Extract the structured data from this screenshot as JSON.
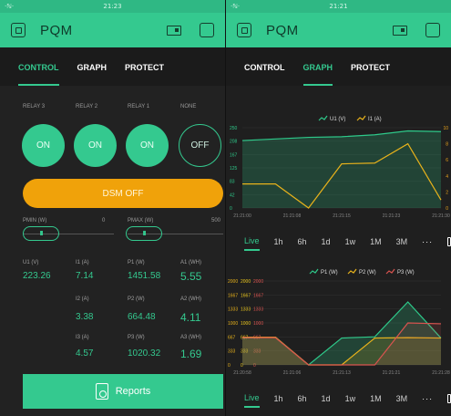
{
  "left": {
    "status": {
      "left": "·ℕ·",
      "time": "21:23",
      "right": ""
    },
    "header": {
      "title": "PQM",
      "icon": "device-icon"
    },
    "tabs": [
      {
        "label": "CONTROL",
        "active": true
      },
      {
        "label": "GRAPH",
        "active": false
      },
      {
        "label": "PROTECT",
        "active": false
      }
    ],
    "relays": [
      {
        "label": "RELAY 3",
        "state": "ON"
      },
      {
        "label": "RELAY 2",
        "state": "ON"
      },
      {
        "label": "RELAY 1",
        "state": "ON"
      },
      {
        "label": "NONE",
        "state": "OFF"
      }
    ],
    "dsm": {
      "label": "DSM OFF"
    },
    "pmin": {
      "label": "PMIN (W)",
      "value": "0",
      "handle": "III"
    },
    "pmax": {
      "label": "PMAX (W)",
      "value": "500",
      "handle": "III"
    },
    "metrics": [
      {
        "label": "U1 (V)",
        "value": "223.26"
      },
      {
        "label": "I1 (A)",
        "value": "7.14"
      },
      {
        "label": "P1 (W)",
        "value": "1451.58"
      },
      {
        "label": "A1 (WH)",
        "value": "5.55"
      },
      {
        "label": "I2 (A)",
        "value": "3.38"
      },
      {
        "label": "P2 (W)",
        "value": "664.48"
      },
      {
        "label": "A2 (WH)",
        "value": "4.11"
      },
      {
        "label": "I3 (A)",
        "value": "4.57"
      },
      {
        "label": "P3 (W)",
        "value": "1020.32"
      },
      {
        "label": "A3 (WH)",
        "value": "1.69"
      }
    ],
    "reports": {
      "label": "Reports"
    }
  },
  "right": {
    "status": {
      "left": "·ℕ·",
      "time": "21:21",
      "right": ""
    },
    "header": {
      "title": "PQM",
      "icon": "device-icon"
    },
    "tabs": [
      {
        "label": "CONTROL",
        "active": false
      },
      {
        "label": "GRAPH",
        "active": true
      },
      {
        "label": "PROTECT",
        "active": false
      }
    ],
    "periods": [
      "Live",
      "1h",
      "6h",
      "1d",
      "1w",
      "1M",
      "3M"
    ],
    "more": "···"
  },
  "chart_data": [
    {
      "type": "line",
      "x": [
        "21:21:00",
        "21:21:08",
        "21:21:15",
        "21:21:23",
        "21:21:30"
      ],
      "series": [
        {
          "name": "U1 (V)",
          "color": "#2ec98a",
          "axis": "left",
          "values": [
            210,
            215,
            220,
            222,
            228,
            240,
            238
          ]
        },
        {
          "name": "I1 (A)",
          "color": "#e8b21b",
          "axis": "right",
          "values": [
            3,
            3,
            0,
            5.5,
            5.6,
            8,
            1
          ]
        }
      ],
      "y_left_ticks": [
        "250",
        "208",
        "167",
        "125",
        "83",
        "42",
        "0"
      ],
      "y_right_ticks": [
        "10",
        "8",
        "6",
        "4",
        "2",
        "0"
      ],
      "y_left_color": "#2ec98a",
      "y_right_color": "#e8a21b"
    },
    {
      "type": "line",
      "x": [
        "21:20:58",
        "21:21:06",
        "21:21:13",
        "21:21:21",
        "21:21:28"
      ],
      "series": [
        {
          "name": "P1 (W)",
          "color": "#2ec98a",
          "values": [
            640,
            660,
            0,
            640,
            670,
            1500,
            640
          ]
        },
        {
          "name": "P2 (W)",
          "color": "#e8b21b",
          "values": [
            660,
            660,
            0,
            0,
            640,
            650,
            640
          ]
        },
        {
          "name": "P3 (W)",
          "color": "#d9534f",
          "values": [
            650,
            650,
            0,
            0,
            0,
            1000,
            980
          ]
        }
      ],
      "y_ticks": [
        [
          "2000",
          "2000",
          "2000"
        ],
        [
          "1667",
          "1667",
          "1667"
        ],
        [
          "1333",
          "1333",
          "1333"
        ],
        [
          "1000",
          "1000",
          "1000"
        ],
        [
          "667",
          "667",
          "667"
        ],
        [
          "333",
          "333",
          "333"
        ],
        [
          "0",
          "0",
          "0"
        ]
      ]
    }
  ]
}
